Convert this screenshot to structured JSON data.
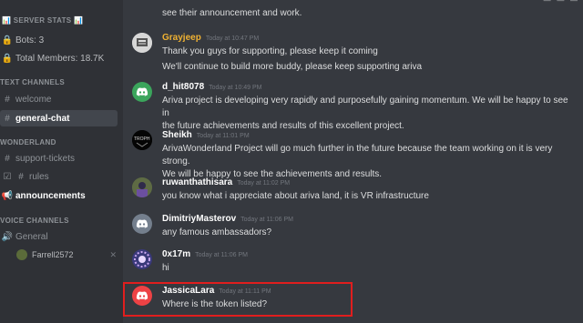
{
  "sidebar": {
    "server_stats_header": "SERVER STATS",
    "stats": [
      {
        "label": "Bots: 3"
      },
      {
        "label": "Total Members: 18.7K"
      }
    ],
    "text_channels_header": "TEXT CHANNELS",
    "text_channels": [
      {
        "label": "welcome"
      },
      {
        "label": "general-chat"
      }
    ],
    "wonderland_header": "WONDERLAND",
    "wonderland_channels": [
      {
        "label": "support-tickets"
      },
      {
        "label": "rules"
      },
      {
        "label": "announcements"
      }
    ],
    "voice_header": "VOICE CHANNELS",
    "voice_channels": [
      {
        "label": "General"
      }
    ],
    "voice_user": "Farrell2572"
  },
  "messages": {
    "top_partial": "see their announcement and work.",
    "items": [
      {
        "username": "Grayjeep",
        "username_color": "#f0b232",
        "timestamp": "Today at 10:47 PM",
        "lines": [
          "Thank you guys for supporting, please keep it coming",
          "We'll continue to build more buddy, please keep supporting ariva"
        ]
      },
      {
        "username": "d_hit8078",
        "username_color": "#ffffff",
        "timestamp": "Today at 10:49 PM",
        "lines": [
          "Ariva project is developing very rapidly and purposefully   gaining momentum. We will be happy to see in",
          "the future achievements and results of this excellent project."
        ]
      },
      {
        "username": "Sheikh",
        "username_color": "#ffffff",
        "timestamp": "Today at 11:01 PM",
        "lines": [
          "ArivaWonderland Project will go much further in the future because the team working on it is very strong.",
          "We will be happy to see the achievements and results."
        ]
      },
      {
        "username": "ruwanthathisara",
        "username_color": "#ffffff",
        "timestamp": "Today at 11:02 PM",
        "lines": [
          "you know what i appreciate about ariva land, it is VR infrastructure"
        ]
      },
      {
        "username": "DimitriyMasterov",
        "username_color": "#ffffff",
        "timestamp": "Today at 11:06 PM",
        "lines": [
          "any famous ambassadors?"
        ]
      },
      {
        "username": "0x17m",
        "username_color": "#ffffff",
        "timestamp": "Today at 11:06 PM",
        "lines": [
          "hi"
        ]
      },
      {
        "username": "JassicaLara",
        "username_color": "#ffffff",
        "timestamp": "Today at 11:11 PM",
        "lines": [
          "Where is the token listed?"
        ]
      }
    ]
  }
}
